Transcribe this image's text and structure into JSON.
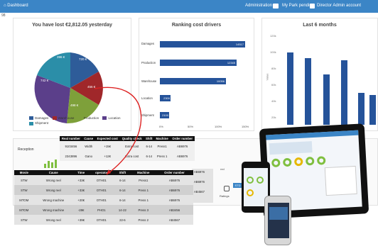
{
  "topbar": {
    "home": "⌂ Dashboard",
    "admin": "Administration",
    "mypark": "My Park pending",
    "account": "Director Admin account"
  },
  "sub": "98",
  "panels": {
    "lost_title": "You have lost €2,812.05 yesterday",
    "ranking_title": "Ranking cost drivers",
    "months_title": "Last 6 months",
    "reception": "Reception"
  },
  "pie_legend": [
    {
      "label": "Damages",
      "color": "#2e5c99"
    },
    {
      "label": "Warehouse",
      "color": "#a0272a"
    },
    {
      "label": "Production",
      "color": "#7ea03a"
    },
    {
      "label": "Location",
      "color": "#5b3f8a"
    },
    {
      "label": "Shipment",
      "color": "#2b8ea8"
    }
  ],
  "pie_labels": [
    "720 €",
    "456 €",
    "498 €",
    "742 €",
    "396 €"
  ],
  "ranking": {
    "categories": [
      "Damages",
      "Production",
      "Warehouse",
      "Location",
      "Shipment"
    ],
    "values": [
      "14517",
      "12345",
      "10056",
      "2300",
      "2100"
    ],
    "axis": [
      "0%",
      "50%",
      "100%",
      "150%"
    ]
  },
  "months_axis": [
    "120k",
    "100k",
    "80k",
    "60k",
    "40k",
    "20k"
  ],
  "months_ylabel": "Value",
  "top_table": {
    "headers": [
      "Real number",
      "Cause",
      "Expected cost",
      "Quality check",
      "Shift",
      "Machine",
      "Order number"
    ],
    "rows": [
      [
        "9103456",
        "Width",
        "+15€",
        "Extra cost",
        "6-14",
        "Press1",
        "AB6976"
      ],
      [
        "2343896",
        "Gano",
        "+12€",
        "Extra cost",
        "6-14",
        "Press 1",
        "AB6976"
      ]
    ]
  },
  "main_table": {
    "headers": [
      "Movie",
      "Cause",
      "Time",
      "operator",
      "Shift",
      "Machine",
      "Order number"
    ],
    "rows": [
      [
        "STW",
        "Wrong reel",
        "+33€",
        "OTH01",
        "6-14",
        "Press1",
        "AB6976"
      ],
      [
        "STW",
        "Wrong reel",
        "+33€",
        "OTH01",
        "6-14",
        "Press 1",
        "AB6976"
      ],
      [
        "MTOM",
        "Wrong machine",
        "+20€",
        "OTH01",
        "6-14",
        "Press 1",
        "AB6976"
      ],
      [
        "MTOM",
        "Wrong machine",
        "-28€",
        "PHO1",
        "14-22",
        "Press 3",
        "AB3456"
      ],
      [
        "STW",
        "Wrong reel",
        "+39€",
        "OTH01",
        "22-6",
        "Press 2",
        "AB4567"
      ]
    ]
  },
  "side_codes": [
    "AB6976",
    "AB6976",
    "AB4567"
  ],
  "misc": {
    "red": "red",
    "badge": "STD",
    "ratings": "Ratings"
  }
}
